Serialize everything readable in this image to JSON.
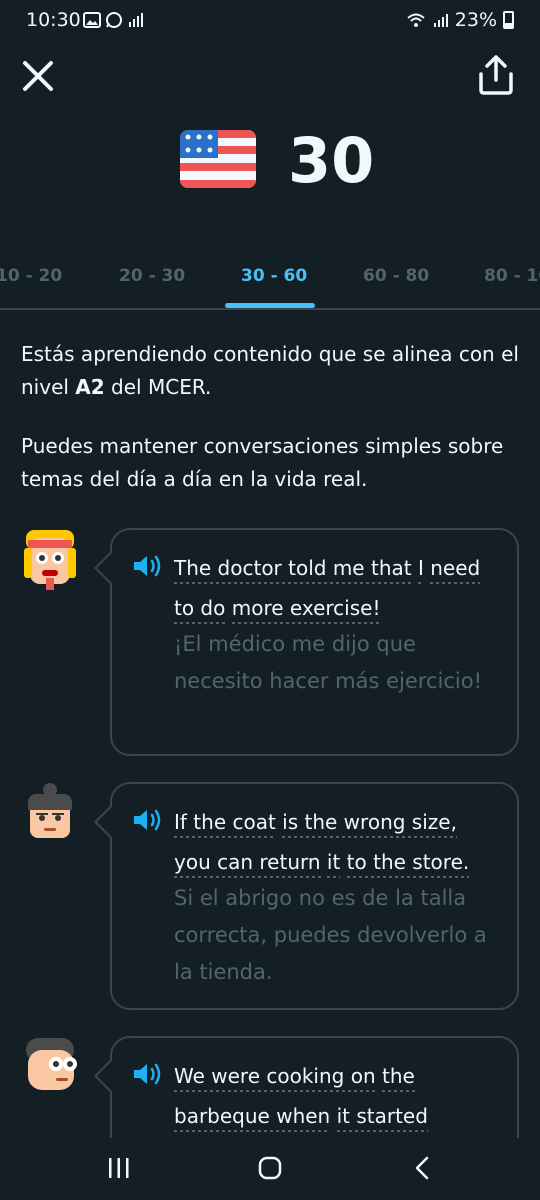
{
  "status_bar": {
    "time": "10:30",
    "battery": "23%"
  },
  "header": {
    "score": "30",
    "flag": "us-flag"
  },
  "tabs": [
    "10 - 20",
    "20 - 30",
    "30 - 60",
    "60 - 80",
    "80 - 10"
  ],
  "active_tab": "30 - 60",
  "description": {
    "p1_before": "Estás aprendiendo contenido que se alinea con el nivel ",
    "p1_bold": "A2",
    "p1_after": " del MCER.",
    "p2": "Puedes mantener conversaciones simples sobre temas del día a día en la vida real."
  },
  "examples": [
    {
      "en_lines": [
        [
          "The doctor told me that",
          "I",
          "need"
        ],
        [
          "to do",
          "more exercise!"
        ]
      ],
      "es": "¡El médico me dijo que necesito hacer más ejercicio!"
    },
    {
      "en_lines": [
        [
          "If the coat",
          "is the wrong size,"
        ],
        [
          "you can return",
          "it",
          "to the store."
        ]
      ],
      "es": "Si el abrigo no es de la talla correcta, puedes devolverlo a la tienda."
    },
    {
      "en_lines": [
        [
          "We were cooking on",
          "the"
        ],
        [
          "barbeque when",
          "it started"
        ]
      ],
      "es": ""
    }
  ],
  "colors": {
    "background": "#131f24",
    "accent": "#49c0f8",
    "muted": "#52656d",
    "border": "#37464f"
  },
  "icons": {
    "close": "close-icon",
    "share": "share-icon",
    "speaker": "speaker-icon"
  }
}
